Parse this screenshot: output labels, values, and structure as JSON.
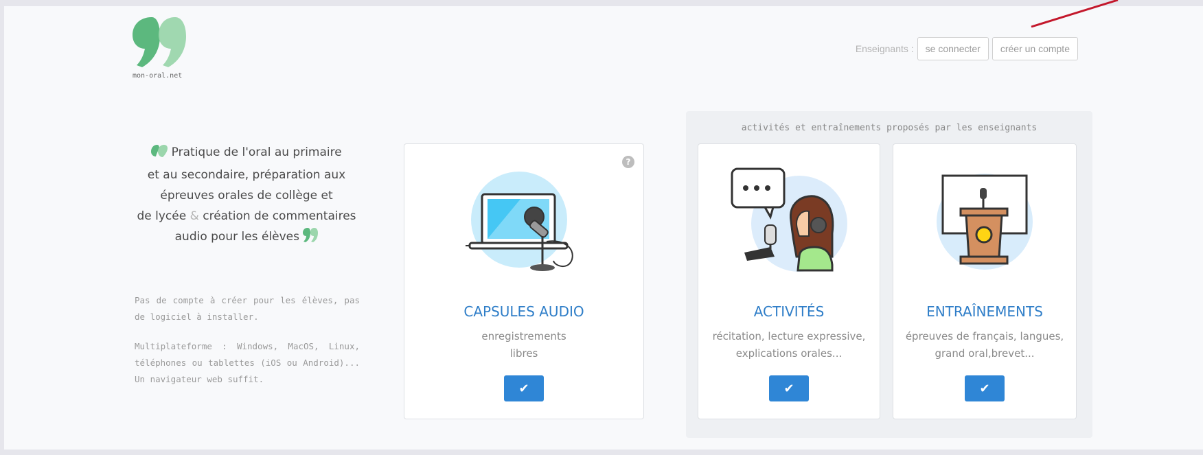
{
  "site": {
    "logo_caption": "mon-oral.net"
  },
  "teacher_bar": {
    "label": "Enseignants :",
    "login_label": "se connecter",
    "signup_label": "créer un compte"
  },
  "intro": {
    "line1": "Pratique de l'oral au primaire",
    "line2": "et au secondaire, préparation aux",
    "line3": "épreuves orales de collège et",
    "line4_a": "de lycée",
    "line4_amp": "&",
    "line4_b": "création de commentaires",
    "line5": "audio pour les élèves"
  },
  "notes": {
    "note1": "Pas de compte à créer pour les élèves, pas de logiciel à installer.",
    "note2": "Multiplateforme : Windows, MacOS, Linux, téléphones ou tablettes (iOS ou Android)... Un navigateur web suffit."
  },
  "group": {
    "title": "activités et entraînements proposés par les enseignants"
  },
  "cards": [
    {
      "title": "CAPSULES AUDIO",
      "desc_line1": "enregistrements",
      "desc_line2": "libres",
      "help": "?"
    },
    {
      "title": "ACTIVITÉS",
      "desc_line1": "récitation, lecture expressive,",
      "desc_line2": "explications orales..."
    },
    {
      "title": "ENTRAÎNEMENTS",
      "desc_line1": "épreuves de français, langues,",
      "desc_line2": "grand oral,brevet..."
    }
  ],
  "icons": {
    "check": "✔"
  },
  "colors": {
    "accent": "#2f86d6",
    "title_blue": "#2f7ec8",
    "logo_dark": "#5cb87e",
    "logo_light": "#9bd6ac",
    "annotation_red": "#c3172b"
  }
}
